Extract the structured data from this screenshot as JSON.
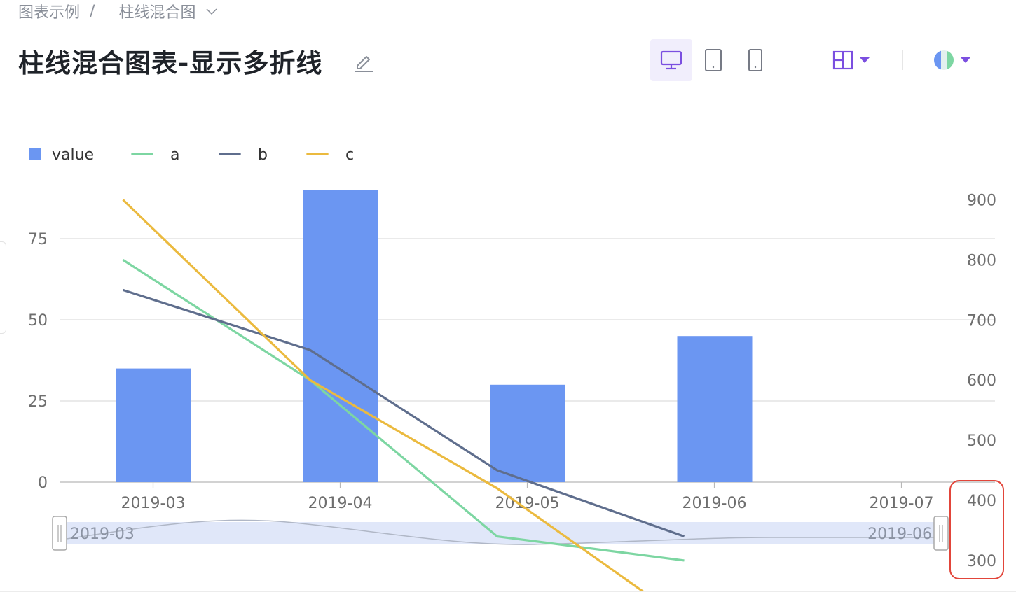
{
  "breadcrumb": {
    "parent": "图表示例",
    "separator": "/",
    "current": "柱线混合图"
  },
  "page": {
    "title": "柱线混合图表-显示多折线"
  },
  "colors": {
    "accent": "#7b4fe0",
    "bar": "#6b96f2",
    "a": "#7dd6a2",
    "b": "#5f6e8d",
    "c": "#ebba3f",
    "grid": "#dddddd",
    "highlight": "#e2453a"
  },
  "toolbar": {
    "icons": [
      "desktop-icon",
      "tablet-icon",
      "mobile-icon",
      "layout-icon",
      "theme-icon"
    ],
    "active": "desktop-icon"
  },
  "chart_data": {
    "type": "bar",
    "categories": [
      "2019-03",
      "2019-04",
      "2019-05",
      "2019-06",
      "2019-07"
    ],
    "series": [
      {
        "name": "value",
        "type": "bar",
        "axis": "left",
        "values": [
          35,
          90,
          30,
          45,
          null
        ]
      },
      {
        "name": "a",
        "type": "line",
        "axis": "right",
        "values": [
          800,
          600,
          340,
          300,
          null
        ]
      },
      {
        "name": "b",
        "type": "line",
        "axis": "right",
        "values": [
          750,
          650,
          450,
          340,
          null
        ]
      },
      {
        "name": "c",
        "type": "line",
        "axis": "right",
        "values": [
          900,
          600,
          420,
          200,
          null
        ]
      }
    ],
    "y_left": {
      "ticks": [
        "0",
        "25",
        "50",
        "75"
      ],
      "range": [
        0,
        90
      ]
    },
    "y_right": {
      "ticks": [
        "300",
        "400",
        "500",
        "600",
        "700",
        "800",
        "900"
      ],
      "range": [
        300,
        900
      ]
    },
    "legend": {
      "position": "top-left",
      "items": [
        "value",
        "a",
        "b",
        "c"
      ]
    },
    "grid": true,
    "datazoom": {
      "start_label": "2019-03",
      "end_label": "2019-06"
    }
  }
}
